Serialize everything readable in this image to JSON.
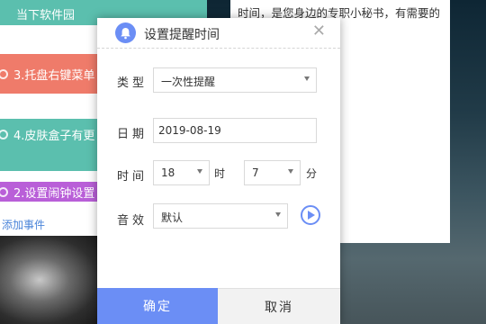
{
  "notes": {
    "items": [
      {
        "text": "当下软件园",
        "color": "#5bbfae"
      },
      {
        "text": "3.托盘右键菜单",
        "color": "#ef7b6a"
      },
      {
        "text": "4.皮肤盒子有更",
        "color": "#5bbfae"
      },
      {
        "text": "2.设置闹钟设置",
        "color": "#b95fd8"
      }
    ],
    "add_event_label": "添加事件"
  },
  "text_panel": {
    "line": "时间，是您身边的专职小秘书，有需要的"
  },
  "dialog": {
    "title": "设置提醒时间",
    "close_symbol": "✕",
    "type": {
      "label": "类型",
      "value": "一次性提醒"
    },
    "date": {
      "label": "日期",
      "value": "2019-08-19"
    },
    "time": {
      "label": "时间",
      "hour": "18",
      "hour_unit": "时",
      "minute": "7",
      "minute_unit": "分"
    },
    "sound": {
      "label": "音效",
      "value": "默认"
    },
    "confirm_label": "确定",
    "cancel_label": "取消",
    "accent_color": "#6b8ef5"
  }
}
